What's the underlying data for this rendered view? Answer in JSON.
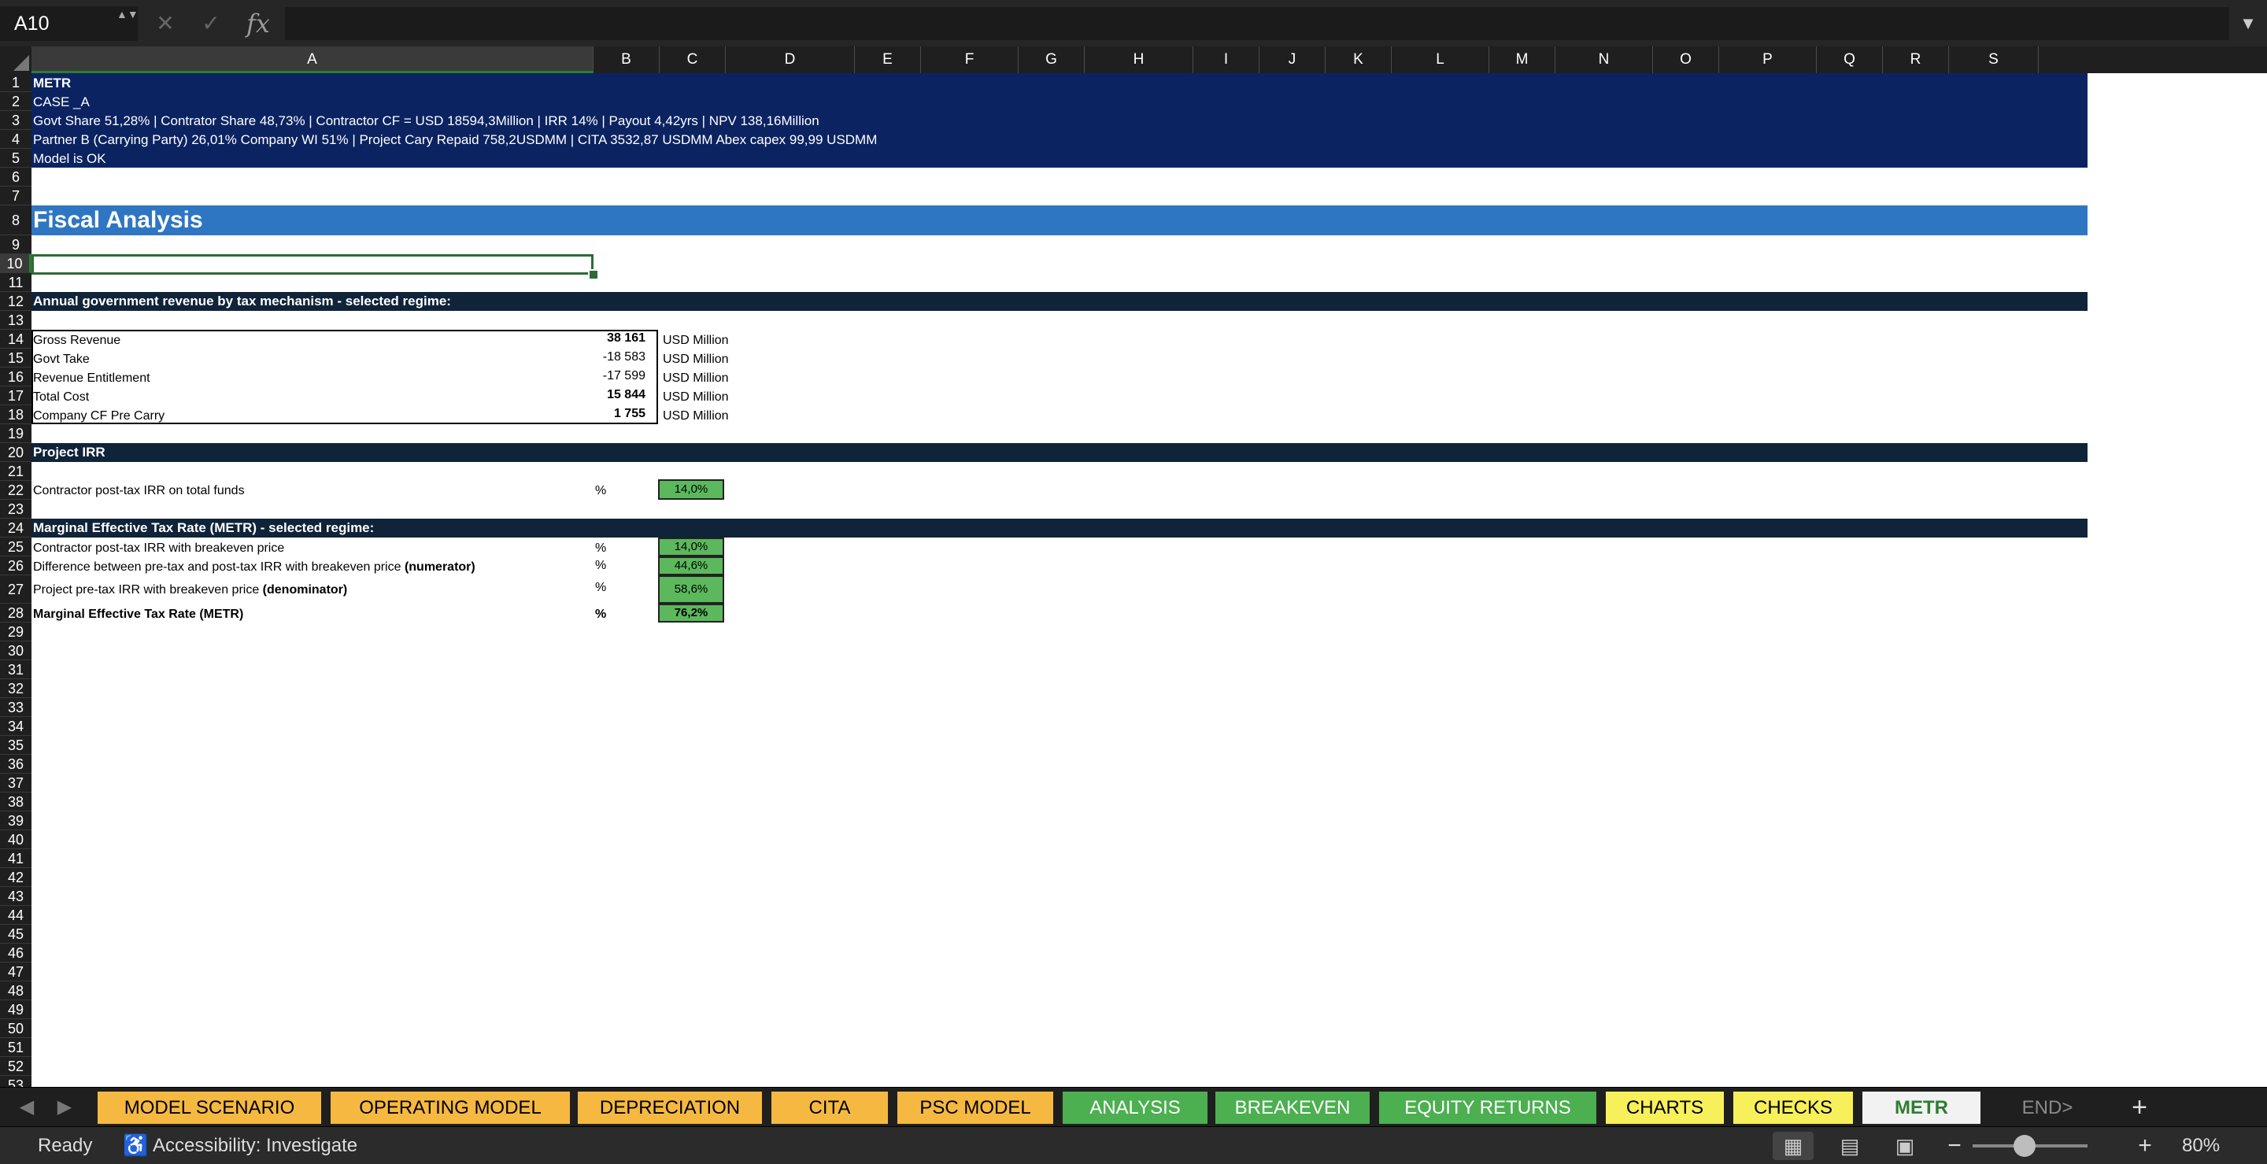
{
  "formula_bar": {
    "name_box": "A10",
    "stepper": "▲▼",
    "cancel_icon": "✕",
    "confirm_icon": "✓",
    "fx_icon": "fx",
    "formula": "",
    "expand_icon": "▼"
  },
  "columns": [
    "A",
    "B",
    "C",
    "D",
    "E",
    "F",
    "G",
    "H",
    "I",
    "J",
    "K",
    "L",
    "M",
    "N",
    "O",
    "P",
    "Q",
    "R",
    "S"
  ],
  "selected_column": "A",
  "rows": [
    "1",
    "2",
    "3",
    "4",
    "5",
    "6",
    "7",
    "8",
    "9",
    "10",
    "11",
    "12",
    "13",
    "14",
    "15",
    "16",
    "17",
    "18",
    "19",
    "20",
    "21",
    "22",
    "23",
    "24",
    "25",
    "26",
    "27",
    "28",
    "29",
    "30",
    "31",
    "32",
    "33",
    "34",
    "35",
    "36",
    "37",
    "38",
    "39",
    "40",
    "41",
    "42",
    "43",
    "44",
    "45",
    "46",
    "47",
    "48",
    "49",
    "50",
    "51",
    "52",
    "53"
  ],
  "selected_row": "10",
  "header_block": {
    "line1": "METR",
    "line2": "CASE _A",
    "line3": "Govt Share 51,28%  | Contrator Share 48,73% |   Contractor CF = USD 18594,3Million | IRR 14% | Payout 4,42yrs | NPV 138,16Million",
    "line4": "Partner B (Carrying Party) 26,01% Company WI 51% |  Project Cary Repaid  758,2USDMM  |  CITA 3532,87  USDMM Abex capex 99,99  USDMM",
    "line5": "Model is OK"
  },
  "fiscal_title": "Fiscal Analysis",
  "section_revenue": {
    "title": "Annual government revenue by tax mechanism - selected regime:",
    "items": [
      {
        "label": "Gross Revenue",
        "value": "38 161",
        "unit": "USD Million"
      },
      {
        "label": "Govt Take",
        "value": "-18 583",
        "unit": "USD Million"
      },
      {
        "label": "Revenue Entitlement",
        "value": "-17 599",
        "unit": "USD Million"
      },
      {
        "label": "Total Cost",
        "value": "15 844",
        "unit": "USD Million"
      },
      {
        "label": "Company CF Pre Carry",
        "value": "1 755",
        "unit": "USD Million"
      }
    ]
  },
  "section_irr": {
    "title": "Project IRR",
    "label": "Contractor post-tax IRR on total funds",
    "unit": "%",
    "value": "14,0%"
  },
  "section_metr": {
    "title": "Marginal Effective Tax Rate (METR) - selected regime:",
    "row25": {
      "label": "Contractor post-tax IRR with breakeven price",
      "unit": "%",
      "value": "14,0%"
    },
    "row26": {
      "label": "Difference between pre-tax and post-tax IRR with breakeven price ",
      "bold": "(numerator)",
      "unit": "%",
      "value": "44,6%"
    },
    "row27": {
      "label": "Project pre-tax IRR with breakeven price ",
      "bold": "(denominator)",
      "unit": "%",
      "value": "58,6%"
    },
    "row28": {
      "label": "Marginal Effective Tax Rate (METR)",
      "unit": "%",
      "value": "76,2%"
    }
  },
  "sheet_tabs": {
    "prev_icon": "◀",
    "next_icon": "▶",
    "tabs": [
      "MODEL SCENARIO",
      "OPERATING MODEL",
      "DEPRECIATION",
      "CITA",
      "PSC MODEL",
      "ANALYSIS",
      "BREAKEVEN",
      "EQUITY RETURNS",
      "CHARTS",
      "CHECKS",
      "METR",
      "END>"
    ],
    "add_icon": "+"
  },
  "status_bar": {
    "ready": "Ready",
    "accessibility_icon": "♿",
    "accessibility": "Accessibility: Investigate",
    "normal_view_icon": "▦",
    "page_layout_icon": "▤",
    "page_break_icon": "▣",
    "zoom_minus": "−",
    "zoom_plus": "+",
    "zoom_level": "80%",
    "zoom_fraction": 0.45
  },
  "colors": {
    "navy_header": "#0b2361",
    "section_dark": "#0f2339",
    "title_blue": "#2f76c2",
    "green_value": "#5cb85c",
    "tab_orange": "#f5b942",
    "tab_green": "#4caf50",
    "tab_yellow": "#f7f05a"
  }
}
